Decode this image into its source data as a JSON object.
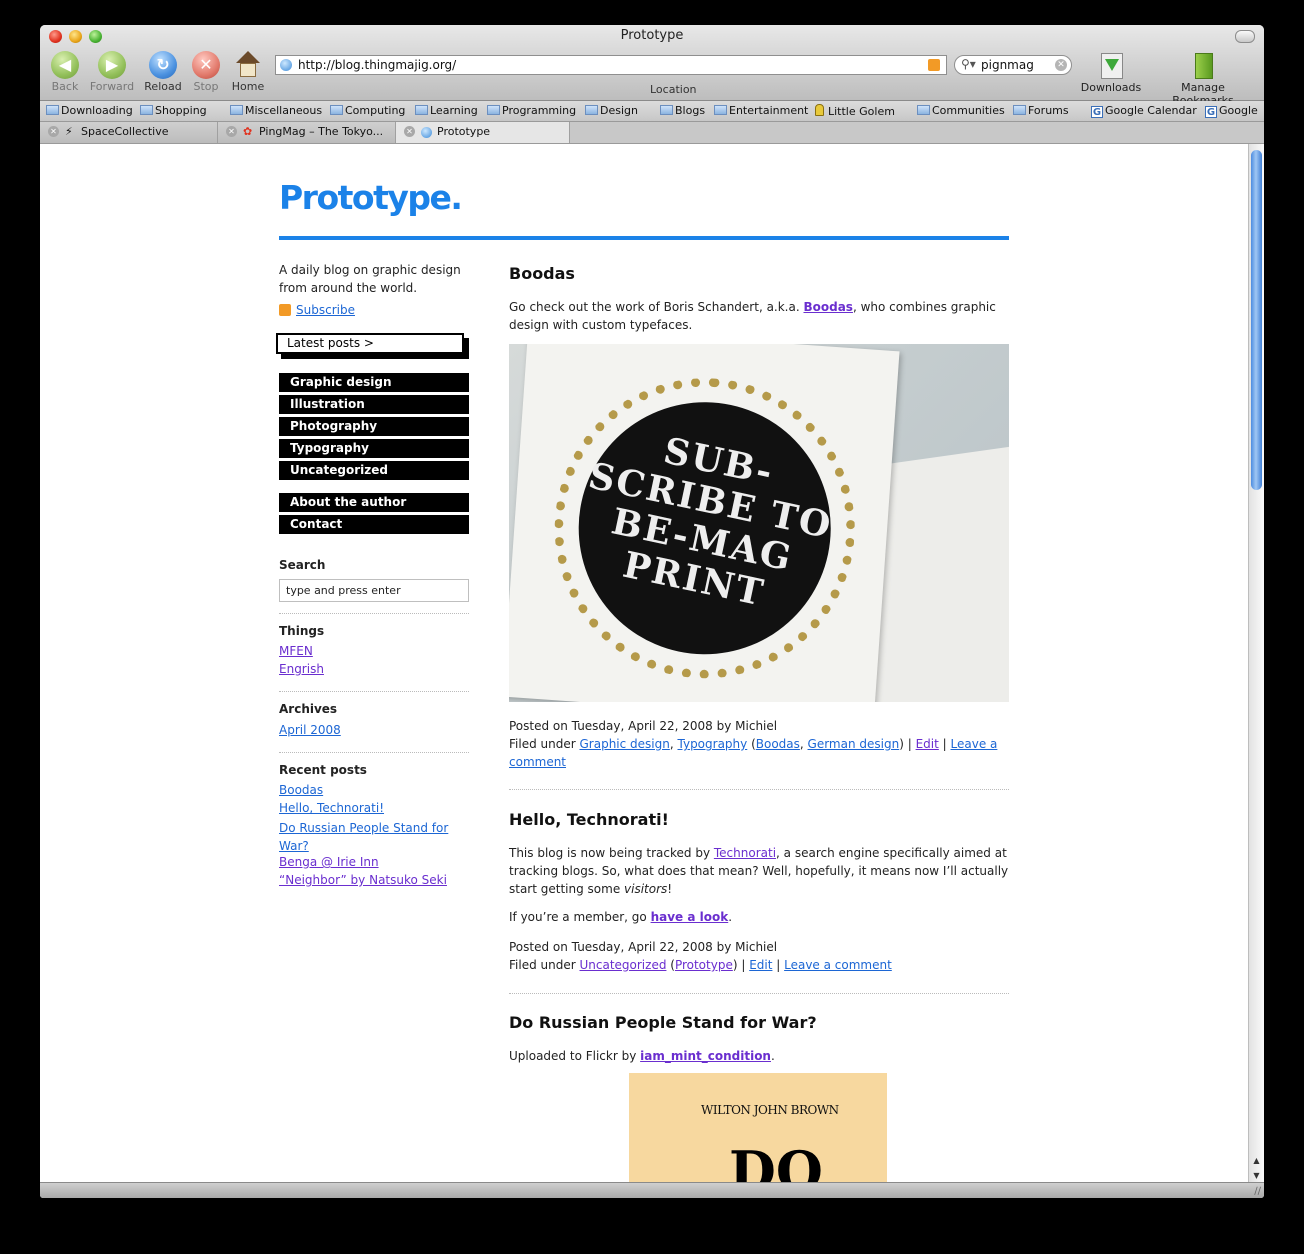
{
  "browser": {
    "window_title": "Prototype",
    "nav": {
      "back": "Back",
      "forward": "Forward",
      "reload": "Reload",
      "stop": "Stop",
      "home": "Home"
    },
    "url": "http://blog.thingmajig.org/",
    "location_label": "Location",
    "search_value": "pignmag",
    "downloads_label": "Downloads",
    "manage_bookmarks_label": "Manage Bookmarks",
    "bookmarks": [
      {
        "label": "Downloading",
        "icon": "folder-icon"
      },
      {
        "label": "Shopping",
        "icon": "folder-icon"
      },
      {
        "label": "Miscellaneous",
        "icon": "folder-icon"
      },
      {
        "label": "Computing",
        "icon": "folder-icon"
      },
      {
        "label": "Learning",
        "icon": "folder-icon"
      },
      {
        "label": "Programming",
        "icon": "folder-icon"
      },
      {
        "label": "Design",
        "icon": "folder-icon"
      },
      {
        "label": "Blogs",
        "icon": "folder-icon"
      },
      {
        "label": "Entertainment",
        "icon": "folder-icon"
      },
      {
        "label": "Little Golem",
        "icon": "golem-icon"
      },
      {
        "label": "Communities",
        "icon": "folder-icon"
      },
      {
        "label": "Forums",
        "icon": "folder-icon"
      },
      {
        "label": "Google Calendar",
        "icon": "google-icon"
      },
      {
        "label": "Google",
        "icon": "google-icon"
      }
    ],
    "tabs": [
      {
        "label": "SpaceCollective",
        "active": false
      },
      {
        "label": "PingMag – The Tokyo...",
        "active": false
      },
      {
        "label": "Prototype",
        "active": true
      }
    ]
  },
  "blog": {
    "logo": "Prototype.",
    "tagline": "A daily blog on graphic design from around the world.",
    "subscribe": "Subscribe",
    "latest_posts": "Latest posts >",
    "categories": [
      "Graphic design",
      "Illustration",
      "Photography",
      "Typography",
      "Uncategorized"
    ],
    "pages": [
      "About the author",
      "Contact"
    ],
    "search_heading": "Search",
    "search_value": "type and press enter",
    "things_heading": "Things",
    "things": [
      "MFEN",
      "Engrish"
    ],
    "archives_heading": "Archives",
    "archives": [
      "April 2008"
    ],
    "recent_heading": "Recent posts",
    "recent": [
      "Boodas",
      "Hello, Technorati!",
      "Do Russian People Stand for War?",
      "Benga @ Irie Inn",
      "“Neighbor” by Natsuko Seki"
    ]
  },
  "posts": [
    {
      "title": "Boodas",
      "intro_before": "Go check out the work of Boris Schandert, a.k.a. ",
      "intro_link": "Boodas",
      "intro_after": ", who combines graphic design with custom typefaces.",
      "image_text": "SUB-SCRIBE TO BE-MAG PRINT",
      "posted": "Posted on Tuesday, April 22, 2008 by Michiel",
      "filed_under": "Filed under ",
      "cat1": "Graphic design",
      "cat2": "Typography",
      "tag1": "Boodas",
      "tag2": "German design",
      "edit": "Edit",
      "comment": "Leave a comment"
    },
    {
      "title": "Hello, Technorati!",
      "p1_before": "This blog is now being tracked by ",
      "p1_link": "Technorati",
      "p1_after": ", a search engine specifically aimed at tracking blogs. So, what does that mean? Well, hopefully, it means now I’ll actually start getting some ",
      "p1_em": "visitors",
      "p1_end": "!",
      "p2_before": "If you’re a member, go ",
      "p2_link": "have a look",
      "p2_after": ".",
      "posted": "Posted on Tuesday, April 22, 2008 by Michiel",
      "filed_under": "Filed under ",
      "cat1": "Uncategorized",
      "tag1": "Prototype",
      "edit": "Edit",
      "comment": "Leave a comment"
    },
    {
      "title": "Do Russian People Stand for War?",
      "intro_before": "Uploaded to Flickr by ",
      "intro_link": "iam_mint_condition",
      "intro_after": ".",
      "book_author": "WILTON JOHN BROWN",
      "book_big": "DO"
    }
  ]
}
